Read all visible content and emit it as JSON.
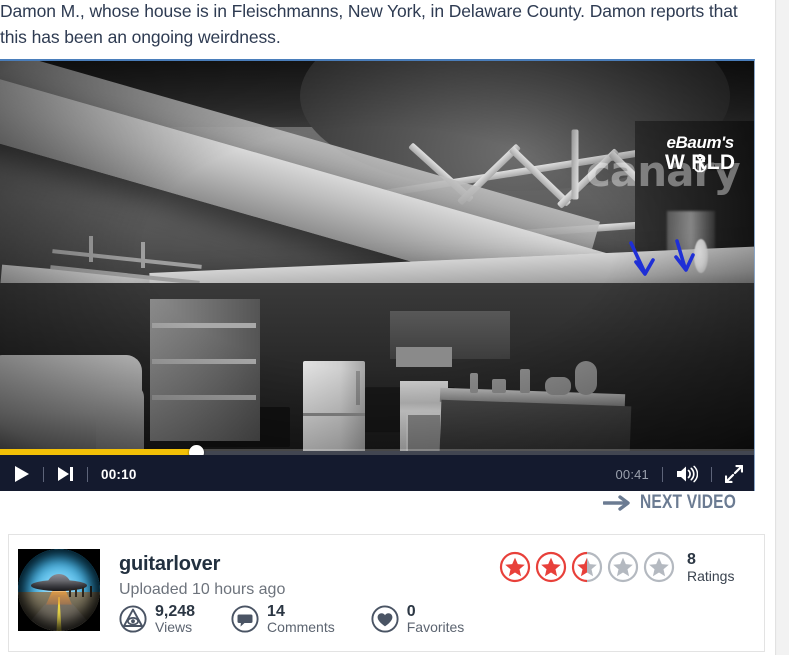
{
  "description": {
    "text": "Damon M., whose house is in Fleischmanns, New York, in Delaware County. Damon reports that this has been an ongoing weirdness."
  },
  "player": {
    "play_label": "play-icon",
    "next_label": "next-track-icon",
    "current_time": "00:10",
    "duration": "00:41",
    "volume_icon": "volume-on-icon",
    "fullscreen_icon": "fullscreen-icon",
    "progress_percent": 26,
    "progress_color": "#f2c007",
    "bar_background": "#141a2e",
    "watermark_primary": "canary",
    "watermark_secondary_line1": "eBaum's",
    "watermark_secondary_line2": "W RLD"
  },
  "next_video": {
    "label": "NEXT VIDEO",
    "arrow_icon": "arrow-right-icon",
    "color": "#6b7b92"
  },
  "uploader": {
    "avatar_icon": "ufo-avatar",
    "username": "guitarlover",
    "uploaded": "Uploaded 10 hours ago"
  },
  "stats": [
    {
      "icon": "eye-views-icon",
      "value": "9,248",
      "label": "Views"
    },
    {
      "icon": "comment-bubble-icon",
      "value": "14",
      "label": "Comments"
    },
    {
      "icon": "heart-icon",
      "value": "0",
      "label": "Favorites"
    }
  ],
  "ratings": {
    "stars": [
      "full",
      "full",
      "half",
      "empty",
      "empty"
    ],
    "count": "8",
    "label": "Ratings",
    "active_color": "#e8403a",
    "inactive_color": "#b4b9c0"
  },
  "annotations": {
    "arrow_color": "#1f2fd6",
    "arrow_count": 2
  },
  "colors": {
    "page_background": "#f0f0f0",
    "content_background": "#ffffff",
    "text_primary": "#2e3b52",
    "text_muted": "#6d737c",
    "player_accent": "#4a7ebb"
  }
}
